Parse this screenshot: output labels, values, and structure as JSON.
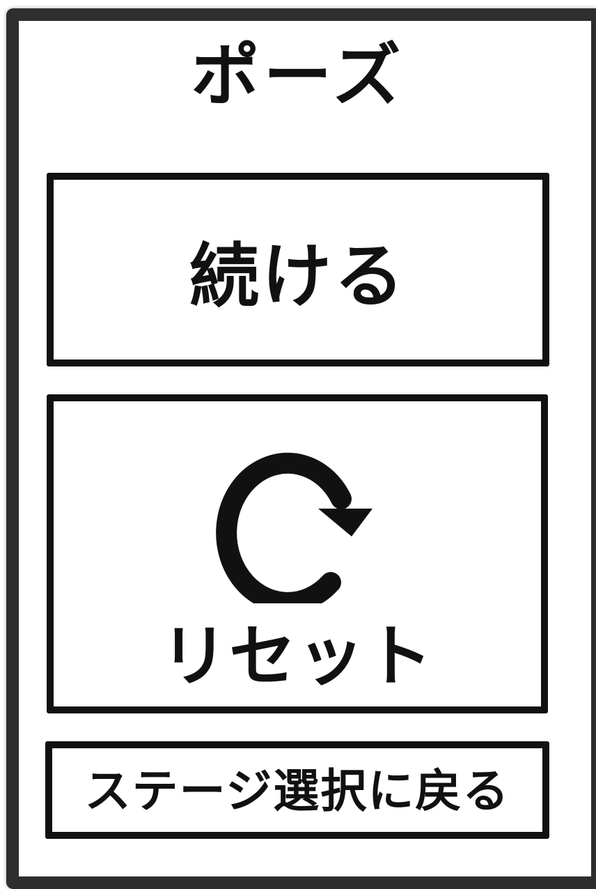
{
  "pause_menu": {
    "title": "ポーズ",
    "continue_label": "続ける",
    "reset_label": "リセット",
    "reset_icon": "refresh-icon",
    "stage_select_label": "ステージ選択に戻る"
  }
}
